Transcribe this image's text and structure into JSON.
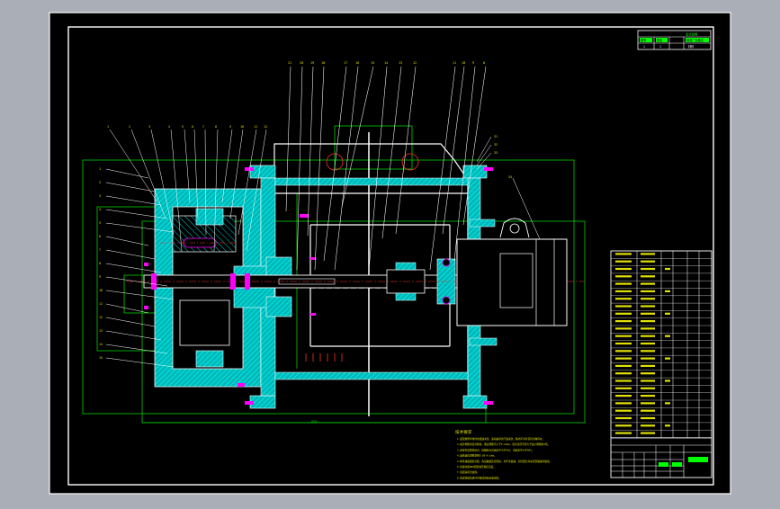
{
  "colors": {
    "viewer_bg": "#a9aeb7",
    "paper": "#000000",
    "outline": "#ffffff",
    "dimension": "#00d000",
    "hatch": "#00c8c8",
    "center_line": "#ff3030",
    "leader": "#ffffff",
    "text_yellow": "#e0e000",
    "highlight": "#ff00ff"
  },
  "drawing": {
    "title_block": {
      "header": "设计说明",
      "col1": "图号",
      "col2": "数量",
      "col3": "制造厂及备注",
      "v1": "1",
      "v2": "1",
      "v3": "材料"
    },
    "tech_requirements": {
      "title": "技术要求",
      "lines": [
        "1.装配前所有零件用煤油清洗，滚动轴承用汽油清洗，箱内不许有任何杂物存在。",
        "2.啮合侧隙用铅丝检验，保证侧隙不小于0.14mm，铅丝直径不得大于最小侧隙的4倍。",
        "3.用涂色法检验斑点，接触斑点沿齿高不小于45%，沿齿长不小于60%。",
        "4.轴承轴向调整游隙0.05~0.1mm。",
        "5.检查减速器剖分面、各接触面及密封处，均不许漏油，剖分面允许涂密封胶或水玻璃。",
        "6.机座内装N68润滑油至规定高度。",
        "7.表面涂灰色油漆。",
        "8.按试验规范进行空载试验和负载试验。"
      ]
    },
    "dimension_label": "850",
    "balloons_top": [
      "21",
      "20",
      "19",
      "18",
      "17",
      "16",
      "15",
      "14",
      "13",
      "12",
      "11",
      "10",
      "9",
      "8"
    ],
    "balloons_left": [
      "1",
      "2",
      "3",
      "4",
      "5",
      "6",
      "7",
      "8",
      "9",
      "10",
      "11",
      "12",
      "13",
      "14",
      "15"
    ],
    "balloons_right": [
      "31",
      "32",
      "33"
    ],
    "motor_balloon": "34"
  }
}
